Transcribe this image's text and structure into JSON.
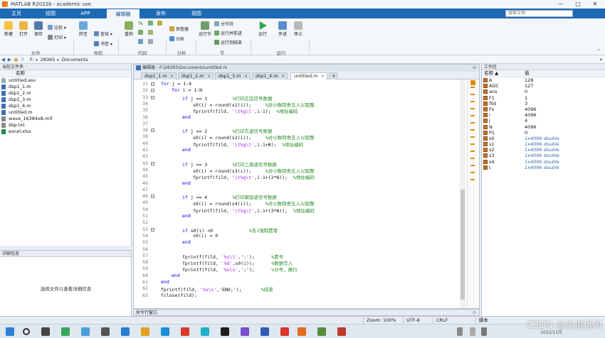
{
  "window": {
    "title": "MATLAB R2022b - academic use",
    "controls": [
      "—",
      "□",
      "✕"
    ]
  },
  "menu_tabs": [
    {
      "label": "主页",
      "active": false
    },
    {
      "label": "绘图",
      "active": false
    },
    {
      "label": "APP",
      "active": false
    },
    {
      "label": "编辑器",
      "active": true
    },
    {
      "label": "发布",
      "active": false
    },
    {
      "label": "视图",
      "active": false
    }
  ],
  "search": {
    "placeholder": "搜索文档",
    "user": "钰 ▾"
  },
  "ribbon": {
    "file": {
      "new": "新建",
      "open": "打开",
      "save": "保存",
      "compare": "比较 ▾",
      "print": "打印 ▾",
      "group": "文件"
    },
    "nav": {
      "goto": "转至",
      "find": "查找 ▾",
      "bookmark": "书签 ▾",
      "group": "导航"
    },
    "code": {
      "refactor": "重构",
      "group": "代码"
    },
    "analyze": {
      "profiler": "探查器",
      "analyze": "分析",
      "group": "分析"
    },
    "section": {
      "run_section": "运行节",
      "section_break": "分节符",
      "run_advance": "运行并前进",
      "run_to_end": "运行到结束",
      "group": "节"
    },
    "run": {
      "run": "运行",
      "step": "步进",
      "stop": "停止",
      "group": "运行"
    }
  },
  "address": {
    "path": [
      "F:",
      "28365",
      "Documents"
    ]
  },
  "current_folder": {
    "title": "当前文件夹",
    "column": "名称",
    "files": [
      {
        "name": "untitled.asv",
        "kind": "asv"
      },
      {
        "name": "dsp1_1.m",
        "kind": "m"
      },
      {
        "name": "dsp1_2.m",
        "kind": "m"
      },
      {
        "name": "dsp1_3.m",
        "kind": "m"
      },
      {
        "name": "dsp1_4.m",
        "kind": "m"
      },
      {
        "name": "untitled.m",
        "kind": "m"
      },
      {
        "name": "wave_16384x8.mif",
        "kind": "mif"
      },
      {
        "name": "dsp.txt",
        "kind": "txt"
      },
      {
        "name": "excel.xlsx",
        "kind": "xlsx"
      }
    ]
  },
  "details": {
    "title": "详细信息",
    "message": "选择文件以查看详细信息"
  },
  "editor": {
    "header": "编辑器 - F:\\28365\\Documents\\untitled.m",
    "tabs": [
      {
        "label": "dsp1_1.m",
        "active": false
      },
      {
        "label": "dsp1_2.m",
        "active": false
      },
      {
        "label": "dsp1_3.m",
        "active": false
      },
      {
        "label": "dsp1_4.m",
        "active": false
      },
      {
        "label": "untitled.m",
        "active": true
      }
    ],
    "lines": [
      {
        "n": "31",
        "indent": 0,
        "segs": [
          {
            "t": "for",
            "c": "kw"
          },
          {
            "t": " j = 1:4"
          }
        ]
      },
      {
        "n": "32",
        "indent": 1,
        "segs": [
          {
            "t": "for",
            "c": "kw"
          },
          {
            "t": " i = 1:N"
          }
        ]
      },
      {
        "n": "33",
        "indent": 2,
        "segs": [
          {
            "t": "if",
            "c": "kw"
          },
          {
            "t": " j == 1         "
          },
          {
            "t": "%打印正弦信号数据",
            "c": "cm"
          }
        ]
      },
      {
        "n": "34",
        "indent": 3,
        "segs": [
          {
            "t": "s0(i) = round(s1(i));     "
          },
          {
            "t": "%对小数四舍五入以取整",
            "c": "cm"
          }
        ]
      },
      {
        "n": "35",
        "indent": 3,
        "segs": [
          {
            "t": "fprintf(fild, "
          },
          {
            "t": "'\\t%g\\t'",
            "c": "st"
          },
          {
            "t": ",i-1);  "
          },
          {
            "t": "%地址编码",
            "c": "cm"
          }
        ]
      },
      {
        "n": "36",
        "indent": 2,
        "segs": [
          {
            "t": "end",
            "c": "kw"
          }
        ]
      },
      {
        "n": "37",
        "indent": 0,
        "segs": []
      },
      {
        "n": "38",
        "indent": 2,
        "segs": [
          {
            "t": "if",
            "c": "kw"
          },
          {
            "t": " j == 2         "
          },
          {
            "t": "%打印方波信号数据",
            "c": "cm"
          }
        ]
      },
      {
        "n": "39",
        "indent": 3,
        "segs": [
          {
            "t": "s0(i) = round(s2(i));     "
          },
          {
            "t": "%对小数四舍五入以取整",
            "c": "cm"
          }
        ]
      },
      {
        "n": "40",
        "indent": 3,
        "segs": [
          {
            "t": "fprintf(fild, "
          },
          {
            "t": "'\\t%g\\t'",
            "c": "st"
          },
          {
            "t": ",i-1+N);  "
          },
          {
            "t": "%地址编码",
            "c": "cm"
          }
        ]
      },
      {
        "n": "41",
        "indent": 2,
        "segs": [
          {
            "t": "end",
            "c": "kw"
          }
        ]
      },
      {
        "n": "42",
        "indent": 0,
        "segs": []
      },
      {
        "n": "43",
        "indent": 2,
        "segs": [
          {
            "t": "if",
            "c": "kw"
          },
          {
            "t": " j == 3         "
          },
          {
            "t": "%打印三角波信号数据",
            "c": "cm"
          }
        ]
      },
      {
        "n": "44",
        "indent": 3,
        "segs": [
          {
            "t": "s0(i) = round(s3(i));     "
          },
          {
            "t": "%对小数四舍五入以取整",
            "c": "cm"
          }
        ]
      },
      {
        "n": "45",
        "indent": 3,
        "segs": [
          {
            "t": "fprintf(fild, "
          },
          {
            "t": "'\\t%g\\t'",
            "c": "st"
          },
          {
            "t": ",i-1+(2*N));  "
          },
          {
            "t": "%地址编码",
            "c": "cm"
          }
        ]
      },
      {
        "n": "46",
        "indent": 2,
        "segs": [
          {
            "t": "end",
            "c": "kw"
          }
        ]
      },
      {
        "n": "47",
        "indent": 0,
        "segs": []
      },
      {
        "n": "48",
        "indent": 2,
        "segs": [
          {
            "t": "if",
            "c": "kw"
          },
          {
            "t": " j == 4         "
          },
          {
            "t": "%打印锯齿波信号数据",
            "c": "cm"
          }
        ]
      },
      {
        "n": "49",
        "indent": 3,
        "segs": [
          {
            "t": "s0(i) = round(s4(i));     "
          },
          {
            "t": "%对小数四舍五入以取整",
            "c": "cm"
          }
        ]
      },
      {
        "n": "50",
        "indent": 3,
        "segs": [
          {
            "t": "fprintf(fild, "
          },
          {
            "t": "'\\t%g\\t'",
            "c": "st"
          },
          {
            "t": ",i-1+(3*N));  "
          },
          {
            "t": "%地址编码",
            "c": "cm"
          }
        ]
      },
      {
        "n": "51",
        "indent": 2,
        "segs": [
          {
            "t": "end",
            "c": "kw"
          }
        ]
      },
      {
        "n": "52",
        "indent": 0,
        "segs": []
      },
      {
        "n": "53",
        "indent": 2,
        "segs": [
          {
            "t": "if",
            "c": "kw"
          },
          {
            "t": " s0(i) <0             "
          },
          {
            "t": "%负1强制置零",
            "c": "cm"
          }
        ]
      },
      {
        "n": "54",
        "indent": 3,
        "segs": [
          {
            "t": "s0(i) = 0"
          }
        ]
      },
      {
        "n": "55",
        "indent": 2,
        "segs": [
          {
            "t": "end",
            "c": "kw"
          }
        ]
      },
      {
        "n": "56",
        "indent": 0,
        "segs": []
      },
      {
        "n": "57",
        "indent": 2,
        "segs": [
          {
            "t": "fprintf(fild, "
          },
          {
            "t": "'%s\\t'",
            "c": "st"
          },
          {
            "t": ",':');      "
          },
          {
            "t": "%冒号",
            "c": "cm"
          }
        ]
      },
      {
        "n": "58",
        "indent": 2,
        "segs": [
          {
            "t": "fprintf(fild, "
          },
          {
            "t": "'%d'",
            "c": "st"
          },
          {
            "t": ",s0(i));      "
          },
          {
            "t": "%数据写入",
            "c": "cm"
          }
        ]
      },
      {
        "n": "59",
        "indent": 2,
        "segs": [
          {
            "t": "fprintf(fild, "
          },
          {
            "t": "'%s\\n'",
            "c": "st"
          },
          {
            "t": ",';');      "
          },
          {
            "t": "%分号，换行",
            "c": "cm"
          }
        ]
      },
      {
        "n": "60",
        "indent": 1,
        "segs": [
          {
            "t": "end",
            "c": "kw"
          }
        ]
      },
      {
        "n": "61",
        "indent": 0,
        "segs": [
          {
            "t": "end",
            "c": "kw"
          }
        ]
      },
      {
        "n": "62",
        "indent": 0,
        "segs": [
          {
            "t": "fprintf(fild, "
          },
          {
            "t": "'%s\\n'",
            "c": "st"
          },
          {
            "t": ",'END;');       "
          },
          {
            "t": "%结束",
            "c": "cm"
          }
        ]
      },
      {
        "n": "63",
        "indent": 0,
        "segs": [
          {
            "t": "fclose(fild);"
          }
        ]
      }
    ]
  },
  "command_window": {
    "label": "命令行窗口"
  },
  "workspace": {
    "title": "工作区",
    "col_name": "名称 ▲",
    "col_value": "值",
    "vars": [
      {
        "name": "A",
        "value": "128",
        "dbl": false
      },
      {
        "name": "ADC",
        "value": "127",
        "dbl": false
      },
      {
        "name": "ans",
        "value": "0",
        "dbl": false
      },
      {
        "name": "F1",
        "value": "1",
        "dbl": false
      },
      {
        "name": "fild",
        "value": "3",
        "dbl": false
      },
      {
        "name": "Fs",
        "value": "4096",
        "dbl": false
      },
      {
        "name": "i",
        "value": "4096",
        "dbl": false
      },
      {
        "name": "j",
        "value": "4",
        "dbl": false
      },
      {
        "name": "N",
        "value": "4096",
        "dbl": false
      },
      {
        "name": "P1",
        "value": "0",
        "dbl": false
      },
      {
        "name": "s0",
        "value": "1x4096 double",
        "dbl": true
      },
      {
        "name": "s1",
        "value": "1x4096 double",
        "dbl": true
      },
      {
        "name": "s2",
        "value": "1x4096 double",
        "dbl": true
      },
      {
        "name": "s3",
        "value": "1x4096 double",
        "dbl": true
      },
      {
        "name": "s4",
        "value": "1x4096 double",
        "dbl": true
      },
      {
        "name": "t",
        "value": "1x4096 double",
        "dbl": true
      }
    ]
  },
  "status": {
    "zoom": "Zoom: 100%",
    "encoding": "UTF-8",
    "eol": "CRLF",
    "mode": "脚本"
  },
  "taskbar": {
    "date": "2022/11/5",
    "watermark": "CSDN @夫追远风"
  }
}
